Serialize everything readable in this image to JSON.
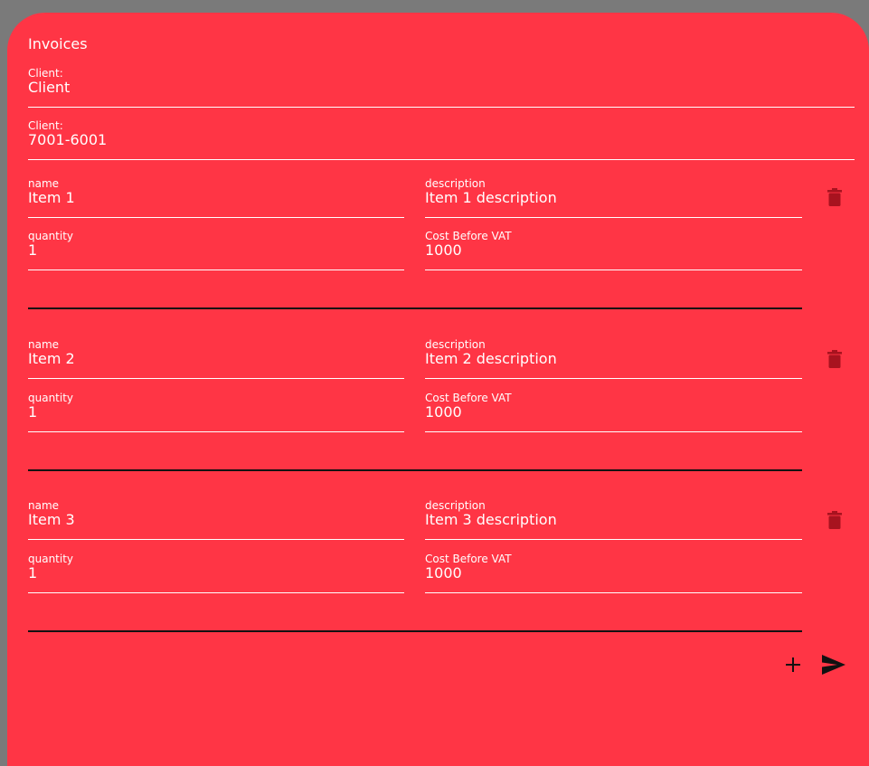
{
  "header": {
    "title": "Invoices"
  },
  "client_fields": [
    {
      "label": "Client:",
      "value": "Client"
    },
    {
      "label": "Client:",
      "value": "7001-6001"
    }
  ],
  "item_labels": {
    "name": "name",
    "description": "description",
    "quantity": "quantity",
    "cost": "Cost Before VAT"
  },
  "items": [
    {
      "name": "Item 1",
      "description": "Item 1 description",
      "quantity": "1",
      "cost": "1000"
    },
    {
      "name": "Item 2",
      "description": "Item 2 description",
      "quantity": "1",
      "cost": "1000"
    },
    {
      "name": "Item 3",
      "description": "Item 3 description",
      "quantity": "1",
      "cost": "1000"
    }
  ],
  "icons": {
    "delete": "trash-icon",
    "add": "plus-icon",
    "send": "send-icon"
  },
  "colors": {
    "card_background": "#ff3545",
    "page_background": "#7a7a7a",
    "delete_icon": "#a8131f",
    "action_icons": "#111111"
  }
}
